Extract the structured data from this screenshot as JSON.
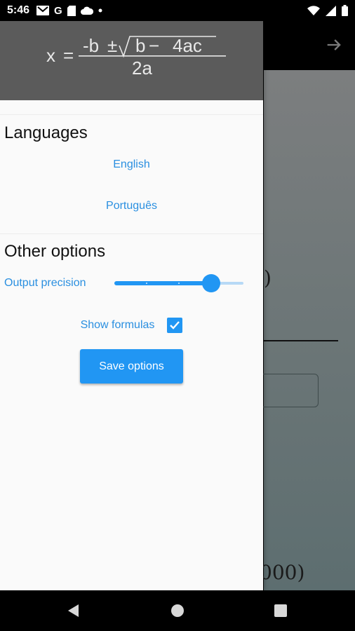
{
  "status_bar": {
    "time": "5:46",
    "icons_left": [
      "gmail-icon",
      "google-icon",
      "sd-card-icon",
      "cloud-icon",
      "dot-icon"
    ],
    "icons_right": [
      "wifi-icon",
      "signal-icon",
      "battery-icon"
    ]
  },
  "drawer": {
    "formula": {
      "x": "x",
      "equals": "=",
      "neg_b": "-b",
      "plus_minus": "±",
      "b": "b",
      "minus": "−",
      "four_ac": "4ac",
      "denominator": "2a"
    },
    "languages": {
      "title": "Languages",
      "items": [
        "English",
        "Português"
      ]
    },
    "other_options": {
      "title": "Other options",
      "precision_label": "Output precision",
      "precision_value": 0.75,
      "show_formulas_label": "Show formulas",
      "show_formulas_checked": true,
      "save_label": "Save options"
    }
  },
  "background": {
    "paren_text": ")",
    "number_text": "000)"
  },
  "colors": {
    "accent": "#2196f3",
    "link": "#2a8fe0",
    "drawer_header": "#5b5b5b"
  },
  "nav_bar": {
    "buttons": [
      "back-icon",
      "home-icon",
      "recents-icon"
    ]
  }
}
